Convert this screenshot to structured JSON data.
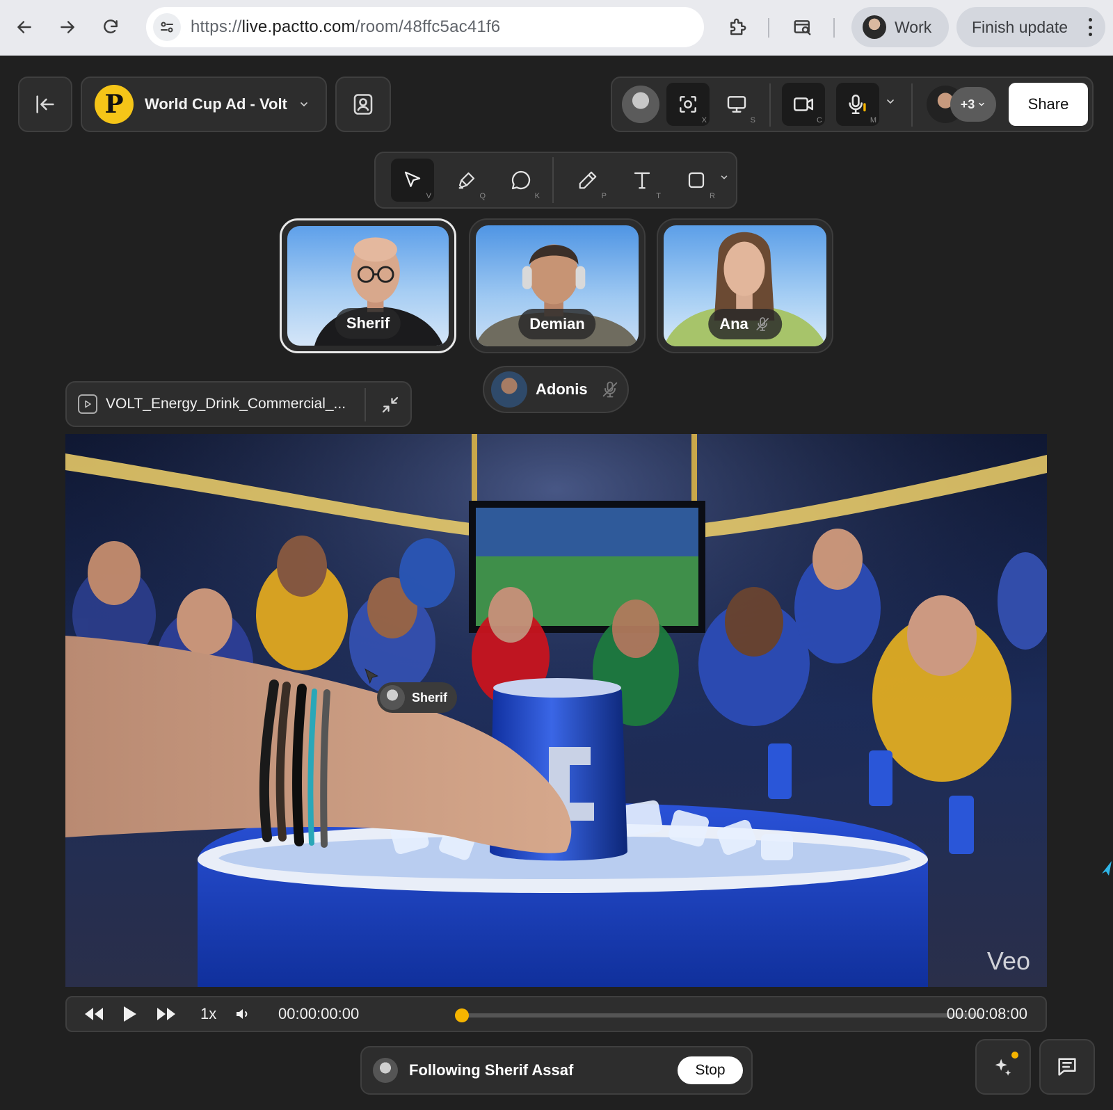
{
  "browser": {
    "url_scheme": "https://",
    "url_domain": "live.pactto.com",
    "url_path": "/room/48ffc5ac41f6",
    "profile_label": "Work",
    "update_label": "Finish update"
  },
  "room": {
    "logo_letter": "P",
    "title": "World Cup Ad - Volt",
    "share_label": "Share",
    "participants_more": "+3",
    "shortcuts": {
      "capture": "X",
      "screen": "S",
      "camera": "C",
      "mic": "M"
    }
  },
  "tools": [
    {
      "name": "select",
      "key": "V"
    },
    {
      "name": "highlighter",
      "key": "Q"
    },
    {
      "name": "comment",
      "key": "K"
    },
    {
      "name": "pencil",
      "key": "P"
    },
    {
      "name": "text",
      "key": "T"
    },
    {
      "name": "rectangle",
      "key": "R"
    }
  ],
  "participants": [
    {
      "name": "Sherif",
      "muted": false,
      "speaking": true
    },
    {
      "name": "Demian",
      "muted": false,
      "speaking": false
    },
    {
      "name": "Ana",
      "muted": true,
      "speaking": false
    },
    {
      "name": "Adonis",
      "muted": true,
      "speaking": false
    }
  ],
  "media": {
    "file_name": "VOLT_Energy_Drink_Commercial_...",
    "watermark": "Veo",
    "cursor_label": "Sherif",
    "current_time": "00:00:00:00",
    "duration": "00:00:08:00",
    "speed": "1x",
    "progress": 0
  },
  "follow": {
    "text": "Following Sherif Assaf",
    "stop_label": "Stop"
  },
  "colors": {
    "accent": "#f5b400",
    "background": "#202020",
    "panel": "#2d2d2d",
    "logo": "#f5c518"
  }
}
